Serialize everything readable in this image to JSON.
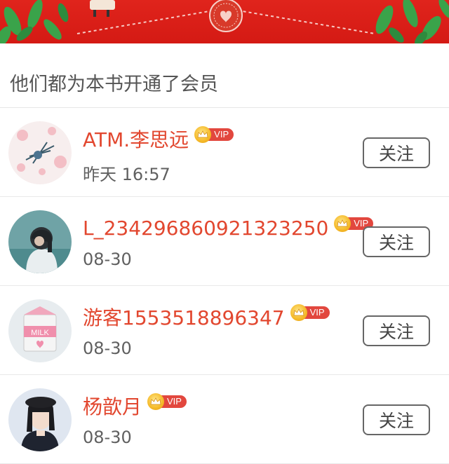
{
  "section": {
    "title": "他们都为本书开通了会员"
  },
  "vip_tag": "VIP",
  "members": [
    {
      "name": "ATM.李思远",
      "date": "昨天 16:57",
      "follow_label": "关注"
    },
    {
      "name": "L_234296860921323250",
      "date": "08-30",
      "follow_label": "关注"
    },
    {
      "name": "游客1553518896347",
      "date": "08-30",
      "follow_label": "关注"
    },
    {
      "name": "杨歆月",
      "date": "08-30",
      "follow_label": "关注"
    }
  ],
  "colors": {
    "banner_red": "#d41a14",
    "name_red": "#e2472f",
    "vip_badge": "#e2473e",
    "crown_gold": "#f5b928"
  },
  "avatar_milk_text": "MILK"
}
